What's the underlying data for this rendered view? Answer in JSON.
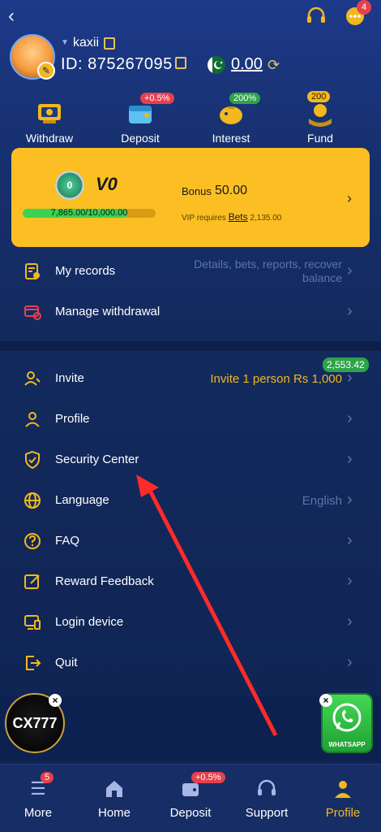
{
  "header": {
    "chat_badge": "4"
  },
  "user": {
    "name": "kaxii",
    "id": "ID: 875267095",
    "balance": "0.00"
  },
  "quick_actions": [
    {
      "label": "Withdraw",
      "badge": ""
    },
    {
      "label": "Deposit",
      "badge": "+0.5%"
    },
    {
      "label": "Interest",
      "badge": "200%"
    },
    {
      "label": "Fund",
      "badge": "200"
    }
  ],
  "vip": {
    "medal": "0",
    "level": "V0",
    "progress_text": "7,865.00/10,000.00",
    "progress_fraction": 0.7865,
    "bonus_label": "Bonus",
    "bonus_value": "50.00",
    "requires_text": "VIP requires",
    "bets_link": "Bets",
    "bets_value": "2,135.00"
  },
  "menu_top": [
    {
      "label": "My records",
      "value": "Details, bets, reports, recover balance"
    },
    {
      "label": "Manage withdrawal",
      "value": ""
    }
  ],
  "menu": [
    {
      "label": "Invite",
      "value": "Invite 1 person Rs 1,000",
      "badge": "2,553.42"
    },
    {
      "label": "Profile",
      "value": ""
    },
    {
      "label": "Security Center",
      "value": ""
    },
    {
      "label": "Language",
      "value": "English"
    },
    {
      "label": "FAQ",
      "value": ""
    },
    {
      "label": "Reward Feedback",
      "value": ""
    },
    {
      "label": "Login device",
      "value": ""
    },
    {
      "label": "Quit",
      "value": ""
    }
  ],
  "floating": {
    "cx_logo": "CX777",
    "whatsapp_label": "WHATSAPP"
  },
  "bottom_nav": [
    {
      "label": "More",
      "badge": "5"
    },
    {
      "label": "Home",
      "badge": ""
    },
    {
      "label": "Deposit",
      "badge": "+0.5%"
    },
    {
      "label": "Support",
      "badge": ""
    },
    {
      "label": "Profile",
      "badge": ""
    }
  ],
  "colors": {
    "accent": "#f2b81e",
    "vip_card": "#fbbf24",
    "green": "#2ea34a",
    "badge_red": "#e5404f"
  }
}
